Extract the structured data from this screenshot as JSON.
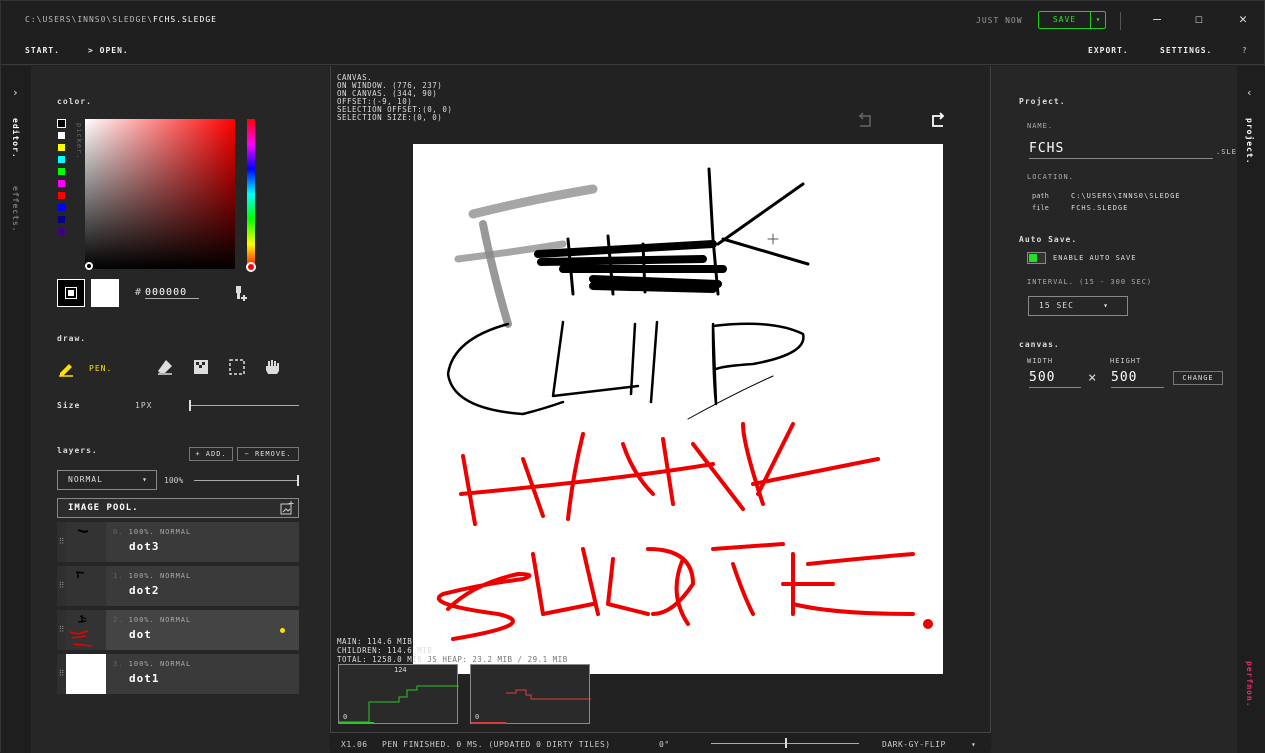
{
  "titlebar": {
    "path_prefix": "C:\\USERS\\INNS0\\SLEDGE\\",
    "file_name": "FCHS.SLEDGE",
    "save_status": "JUST NOW",
    "save_label": "SAVE",
    "save_dropdown": "▾",
    "minimize": "—",
    "maximize": "☐",
    "close": "✕"
  },
  "menubar": {
    "start": "START.",
    "open": "> OPEN.",
    "export": "EXPORT.",
    "settings": "SETTINGS.",
    "help": "?"
  },
  "left_strip": {
    "toggle": "›",
    "editor_tab": "editor.",
    "effects_tab": "effects."
  },
  "color": {
    "heading": "color.",
    "picker_label": "picker.",
    "hex_prefix": "#",
    "hex_value": "000000",
    "primary": "#000000",
    "secondary": "#ffffff",
    "hue": "#ff0000",
    "palette": [
      "#ffffff",
      "#ffff00",
      "#00ffff",
      "#00ff00",
      "#ff00ff",
      "#ff0000",
      "#0000ff",
      "#000080",
      "#400080"
    ],
    "eyedropper_icon": "⚲"
  },
  "draw": {
    "heading": "draw.",
    "active_tool": "PEN.",
    "size_label": "Size",
    "size_value": "1PX"
  },
  "layers": {
    "heading": "layers.",
    "add": "+ ADD.",
    "remove": "− REMOVE.",
    "blend_mode": "NORMAL",
    "blend_arrow": "▾",
    "opacity": "100%",
    "image_pool": "IMAGE POOL.",
    "items": [
      {
        "index": "0.",
        "meta": "100%. NORMAL",
        "name": "dot3"
      },
      {
        "index": "1.",
        "meta": "100%. NORMAL",
        "name": "dot2"
      },
      {
        "index": "2.",
        "meta": "100%. NORMAL",
        "name": "dot"
      },
      {
        "index": "3.",
        "meta": "100%. NORMAL",
        "name": "dot1"
      }
    ]
  },
  "canvas_info": {
    "line1": "CANVAS.",
    "line2": "ON WINDOW. (776, 237)",
    "line3": "ON CANVAS. (344, 90)",
    "line4": "OFFSET:(-9, 10)",
    "line5": "SELECTION OFFSET:(0, 0)",
    "line6": "SELECTION SIZE:(0, 0)"
  },
  "memory": {
    "main": "MAIN: 114.6 MIB",
    "children": "CHILDREN: 114.6 MIB",
    "total": "TOTAL: 1258.0 MIB",
    "heap": "JS HEAP: 23.2 MIB / 29.1 MIB",
    "graph1_top": "124",
    "graph1_bottom": "0",
    "graph2_bottom": "0"
  },
  "status": {
    "zoom": "X1.06",
    "message": "PEN FINISHED. 0 MS. (UPDATED 0 DIRTY TILES)",
    "rotation": "0°",
    "theme": "DARK-GY-FLIP",
    "theme_arrow": "▾"
  },
  "project": {
    "heading": "Project.",
    "name_label": "NAME.",
    "name_value": "FCHS",
    "ext": ".SLEDGE",
    "location_label": "LOCATION.",
    "path_key": "path",
    "path_value": "C:\\USERS\\INNS0\\SLEDGE",
    "file_key": "file",
    "file_value": "FCHS.SLEDGE",
    "autosave_heading": "Auto Save.",
    "autosave_toggle": "ENABLE AUTO SAVE",
    "autosave_enabled": true,
    "interval_label": "INTERVAL. (15 - 300 SEC)",
    "interval_value": "15 SEC",
    "interval_arrow": "▾",
    "canvas_heading": "canvas.",
    "width_label": "WIDTH",
    "height_label": "HEIGHT",
    "width_value": "500",
    "height_value": "500",
    "times": "×",
    "change": "CHANGE"
  },
  "right_strip": {
    "toggle": "‹",
    "project_tab": "project.",
    "perf_tab": "perfmon."
  }
}
